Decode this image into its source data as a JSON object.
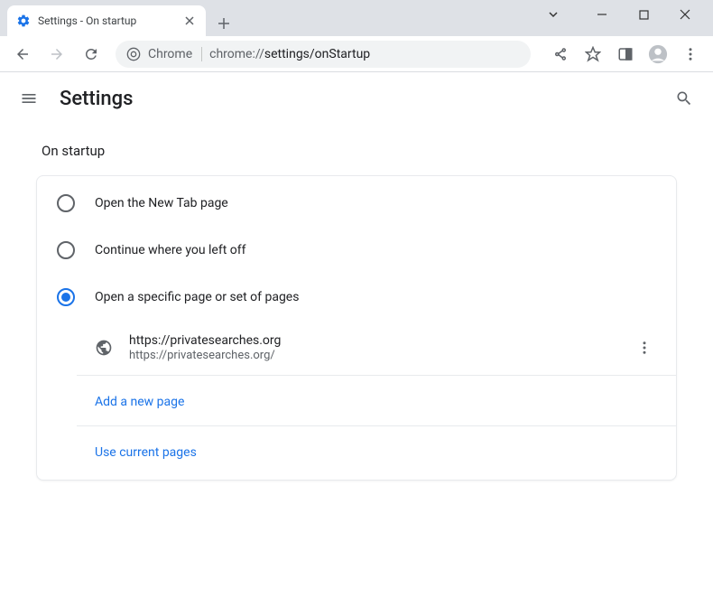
{
  "tab": {
    "title": "Settings - On startup"
  },
  "omnibox": {
    "chip": "Chrome",
    "url_gray": "chrome://",
    "url_dark": "settings/onStartup"
  },
  "settings": {
    "title": "Settings"
  },
  "section": {
    "title": "On startup"
  },
  "options": {
    "opt1": "Open the New Tab page",
    "opt2": "Continue where you left off",
    "opt3": "Open a specific page or set of pages"
  },
  "page_entry": {
    "title": "https://privatesearches.org",
    "url": "https://privatesearches.org/"
  },
  "links": {
    "add": "Add a new page",
    "use_current": "Use current pages"
  }
}
